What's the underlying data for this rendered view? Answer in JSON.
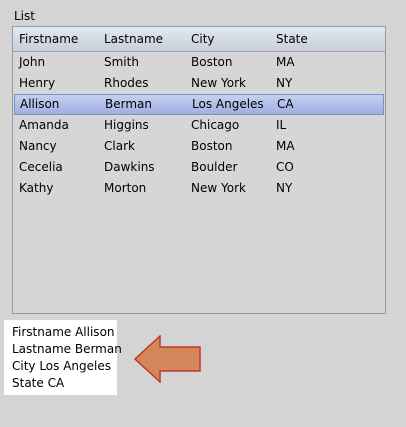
{
  "group": {
    "label": "List"
  },
  "columns": [
    {
      "label": "Firstname"
    },
    {
      "label": "Lastname"
    },
    {
      "label": "City"
    },
    {
      "label": "State"
    }
  ],
  "rows": [
    {
      "firstname": "John",
      "lastname": "Smith",
      "city": "Boston",
      "state": "MA"
    },
    {
      "firstname": "Henry",
      "lastname": "Rhodes",
      "city": "New York",
      "state": "NY"
    },
    {
      "firstname": "Allison",
      "lastname": "Berman",
      "city": "Los Angeles",
      "state": "CA"
    },
    {
      "firstname": "Amanda",
      "lastname": "Higgins",
      "city": "Chicago",
      "state": "IL"
    },
    {
      "firstname": "Nancy",
      "lastname": "Clark",
      "city": "Boston",
      "state": "MA"
    },
    {
      "firstname": "Cecelia",
      "lastname": "Dawkins",
      "city": "Boulder",
      "state": "CO"
    },
    {
      "firstname": "Kathy",
      "lastname": "Morton",
      "city": "New York",
      "state": "NY"
    }
  ],
  "selected_row_index": 2,
  "details": {
    "firstname_line": "Firstname Allison",
    "lastname_line": "Lastname Berman",
    "city_line": "City Los Angeles",
    "state_line": "State CA"
  },
  "icons": {
    "arrow": "left-arrow-icon"
  },
  "colors": {
    "arrow_fill": "#d4875a",
    "arrow_stroke": "#c0392b",
    "selection": "#a9b8e6"
  }
}
